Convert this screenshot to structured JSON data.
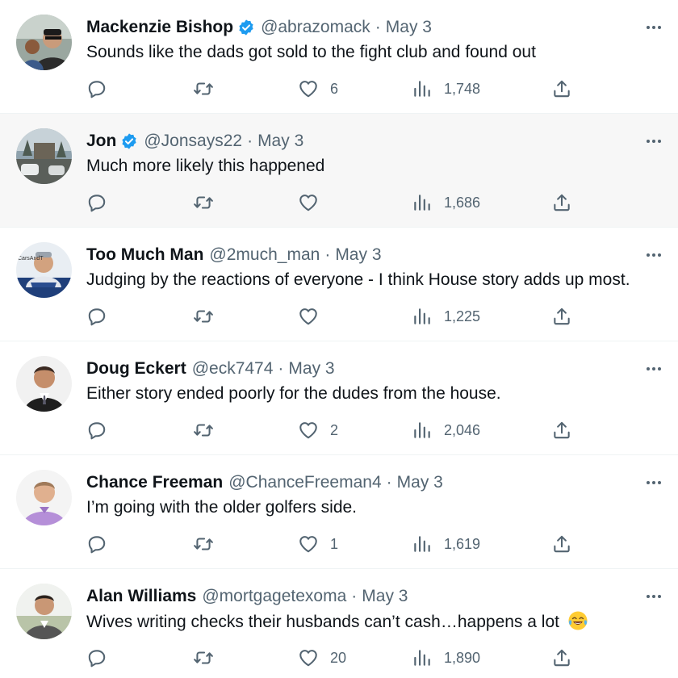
{
  "colors": {
    "text": "#0f1419",
    "muted": "#536471",
    "verified": "#1d9bf0",
    "highlight_row": "#f7f7f7",
    "divider": "#eff3f4"
  },
  "icons": {
    "reply": "reply-icon",
    "retweet": "retweet-icon",
    "like": "heart-icon",
    "views": "views-chart-icon",
    "share": "share-icon",
    "more": "more-dots-icon",
    "verified": "verified-badge-icon"
  },
  "tweets": [
    {
      "name": "Mackenzie Bishop",
      "verified": true,
      "handle": "@abrazomack",
      "separator": "·",
      "date": "May 3",
      "text": "Sounds like the dads got sold to the fight club and found out",
      "likes": "6",
      "views": "1,748"
    },
    {
      "name": "Jon",
      "verified": true,
      "handle": "@Jonsays22",
      "separator": "·",
      "date": "May 3",
      "text": "Much more likely this happened",
      "likes": "",
      "views": "1,686"
    },
    {
      "name": "Too Much Man",
      "verified": false,
      "handle": "@2much_man",
      "separator": "·",
      "date": "May 3",
      "text": "Judging by the reactions of everyone - I think House story adds up most.",
      "likes": "",
      "views": "1,225",
      "avatar_text": "CarsAndT"
    },
    {
      "name": "Doug Eckert",
      "verified": false,
      "handle": "@eck7474",
      "separator": "·",
      "date": "May 3",
      "text": "Either story ended poorly for the dudes from the house.",
      "likes": "2",
      "views": "2,046"
    },
    {
      "name": "Chance Freeman",
      "verified": false,
      "handle": "@ChanceFreeman4",
      "separator": "·",
      "date": "May 3",
      "text": "I’m going with the older golfers side.",
      "likes": "1",
      "views": "1,619"
    },
    {
      "name": "Alan Williams",
      "verified": false,
      "handle": "@mortgagetexoma",
      "separator": "·",
      "date": "May 3",
      "text": "Wives writing checks their husbands can’t cash…happens a lot",
      "emoji": "tears-of-joy-emoji",
      "likes": "20",
      "views": "1,890"
    }
  ]
}
